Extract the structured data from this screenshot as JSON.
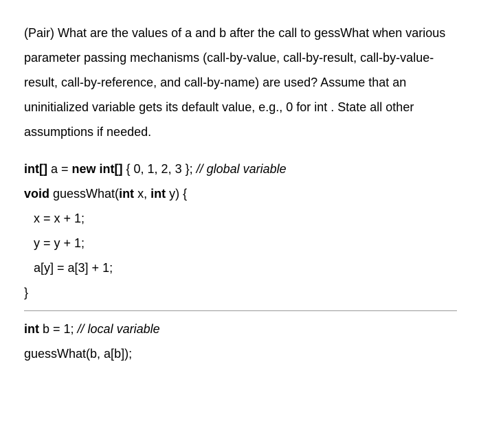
{
  "question": "(Pair) What are the values of a and b after the call to gessWhat when various parameter passing mechanisms (call-by-value, call-by-result, call-by-value-result, call-by-reference, and call-by-name) are used? Assume that an uninitialized variable gets its default value, e.g., 0 for int . State all other assumptions if needed.",
  "code": {
    "decl_int_arr": "int[]",
    "a_eq": " a = ",
    "new_int_arr": "new int[]",
    "arr_init": " { 0, 1, 2, 3 }; ",
    "comment_global": "// global variable",
    "void_kw": "void",
    "guesswhat": " guessWhat(",
    "int_kw1": "int",
    "x_param": " x, ",
    "int_kw2": "int",
    "y_param": " y) {",
    "line_x": "x = x + 1;",
    "line_y": "y = y + 1;",
    "line_a": "a[y] = a[3] + 1;",
    "close_brace": "}",
    "int_kw3": "int",
    "b_decl": " b = 1; ",
    "comment_local": "// local variable",
    "call": "guessWhat(b, a[b]);"
  }
}
